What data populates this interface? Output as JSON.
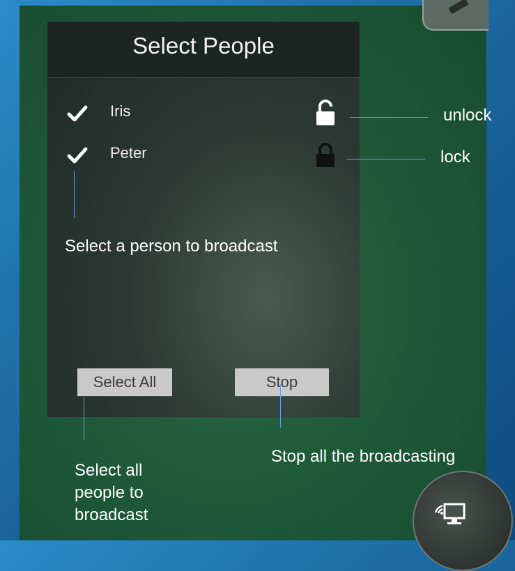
{
  "panel": {
    "title": "Select People",
    "people": [
      {
        "name": "Iris",
        "checked": true,
        "lock_state": "unlocked",
        "icon": "unlock-icon"
      },
      {
        "name": "Peter",
        "checked": true,
        "lock_state": "locked",
        "icon": "lock-icon"
      }
    ],
    "select_all_label": "Select All",
    "stop_label": "Stop"
  },
  "annotations": {
    "unlock": "unlock",
    "lock": "lock",
    "select_person": "Select a person to broadcast",
    "select_all": [
      "Select all",
      "people to",
      "broadcast"
    ],
    "stop_all": "Stop all the broadcasting"
  },
  "icons": {
    "check": "checkmark-icon",
    "corner": "pencil-icon",
    "broadcast": "broadcast-icon"
  },
  "colors": {
    "board": "#1f5a39",
    "panel": "#1e2925",
    "button": "#c9c9c9",
    "annotation_line": "#6da0d6",
    "background": "#1f6fa8"
  }
}
